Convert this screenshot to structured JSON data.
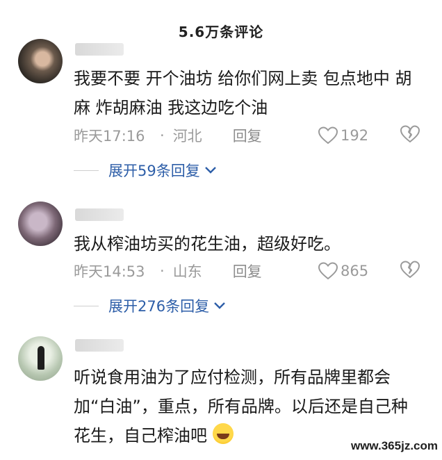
{
  "header": {
    "title": "5.6万条评论"
  },
  "comments": [
    {
      "text": "我要不要 开个油坊 给你们网上卖 包点地中 胡麻 炸胡麻油 我这边吃个油",
      "time": "昨天17:16",
      "location": "河北",
      "reply_label": "回复",
      "likes": "192",
      "expand_label": "展开59条回复"
    },
    {
      "text": "我从榨油坊买的花生油，超级好吃。",
      "time": "昨天14:53",
      "location": "山东",
      "reply_label": "回复",
      "likes": "865",
      "expand_label": "展开276条回复"
    },
    {
      "text": "听说食用油为了应付检测，所有品牌里都会加“白油”，重点，所有品牌。以后还是自己种花生，自己榨油吧",
      "emoji": "rofl-emoji"
    }
  ],
  "watermark": "www.365jz.com",
  "icons": {
    "like": "heart-outline-icon",
    "dislike": "broken-heart-icon",
    "expand": "chevron-down-icon"
  },
  "colors": {
    "link": "#2d5ea8",
    "meta": "#9a9a9a"
  }
}
